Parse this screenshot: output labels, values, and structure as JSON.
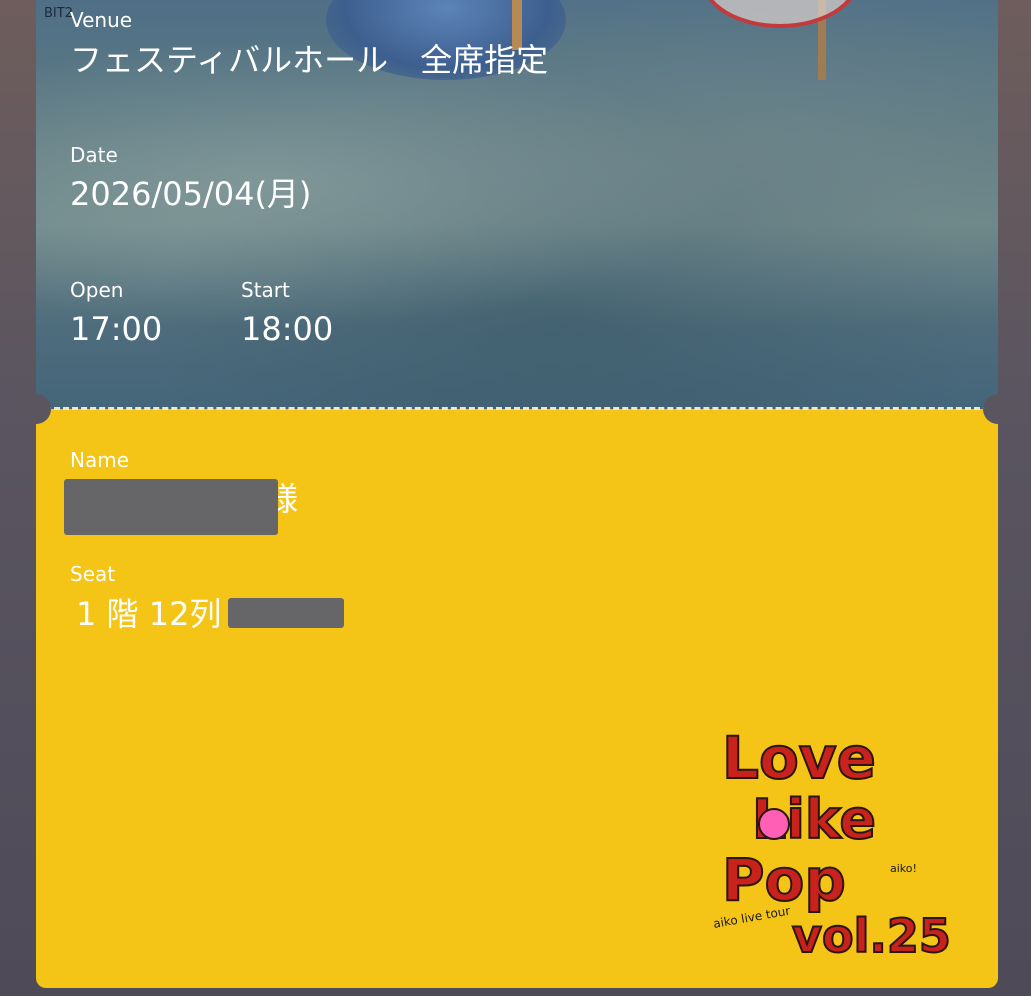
{
  "ticket": {
    "venue_label": "Venue",
    "venue_value": "フェスティバルホール　全席指定",
    "date_label": "Date",
    "date_value": "2026/05/04(月)",
    "open_label": "Open",
    "open_value": "17:00",
    "start_label": "Start",
    "start_value": "18:00",
    "name_label": "Name",
    "name_suffix": "様",
    "seat_label": "Seat",
    "seat_value": "1 階 12列"
  },
  "hero": {
    "tiny_text": "BIT2"
  },
  "logo": {
    "line1": "Love",
    "line2": "Like",
    "line3": "Pop",
    "line4": "vol.25",
    "sub": "aiko live tour",
    "tag": "aiko!"
  },
  "colors": {
    "accent_yellow": "#f4c417",
    "logo_red": "#c7221c",
    "text_white": "#ffffff"
  }
}
